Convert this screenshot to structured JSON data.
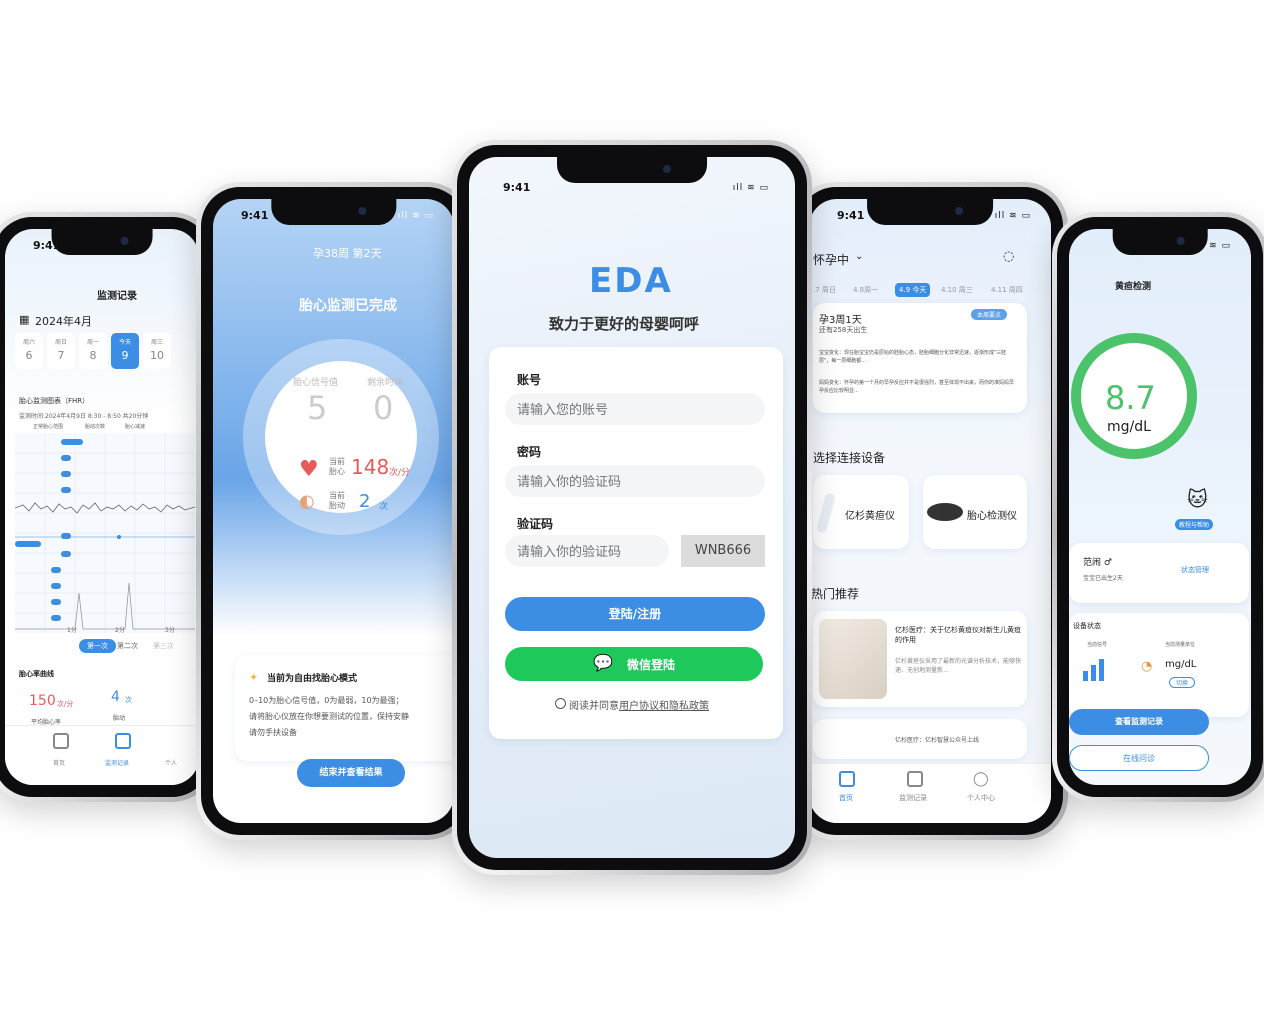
{
  "status": {
    "time": "9:41",
    "icons": "ıll ≋ ▭"
  },
  "p1": {
    "title": "监测记录",
    "month": "2024年4月",
    "days": [
      {
        "w": "周六",
        "d": "6"
      },
      {
        "w": "周日",
        "d": "7"
      },
      {
        "w": "周一",
        "d": "8"
      },
      {
        "w": "今天",
        "d": "9"
      },
      {
        "w": "周三",
        "d": "10"
      }
    ],
    "chart_title": "胎心监测图表（FHR）",
    "chart_time": "监测时间:2024年4月9日 8:30 - 8:50  共20分钟",
    "legend": [
      "正常胎心范围",
      "胎动次数",
      "胎心减速"
    ],
    "chart_ticks": [
      "1分",
      "2分",
      "3分"
    ],
    "toggles": [
      "第一次",
      "第二次",
      "第三次"
    ],
    "section": "胎心率曲线",
    "stats": [
      {
        "value": "150",
        "unit": "次/分",
        "label": "平均胎心率"
      },
      {
        "value": "4",
        "unit": "次",
        "label": "胎动"
      }
    ],
    "tabs": [
      "首页",
      "监测记录",
      "个人"
    ]
  },
  "p2": {
    "header": "孕38周  第2天",
    "title": "胎心监测已完成",
    "col1_label": "胎心信号值",
    "col2_label": "剩余时间",
    "col1_value": "5",
    "col2_value": "0",
    "hr_label": "当前\n胎心",
    "hr_value": "148",
    "hr_unit": "次/分",
    "mv_label": "当前\n胎动",
    "mv_value": "2",
    "mv_unit": "次",
    "mode_title": "当前为自由找胎心模式",
    "mode_text1": "0–10为胎心信号值，0为最弱，10为最强；",
    "mode_text2": "请将胎心仪放在你想要测试的位置，保持安静",
    "mode_text3": "请勿手扶设备",
    "button": "结束并查看结果"
  },
  "p3": {
    "logo": "EDA",
    "slogan": "致力于更好的母婴呵呼",
    "account_label": "账号",
    "account_placeholder": "请输入您的账号",
    "password_label": "密码",
    "password_placeholder": "请输入你的验证码",
    "code_label": "验证码",
    "code_placeholder": "请输入你的验证码",
    "captcha": "WNB666",
    "login_button": "登陆/注册",
    "wechat_button": "微信登陆",
    "agreement_prefix": "阅读并同意",
    "agreement_link": "用户协议和隐私政策"
  },
  "p4": {
    "status": "怀孕中",
    "dates": [
      ".7 周日",
      "4.8周一",
      "4.9 今天",
      "4.10 周三",
      "4.11 周四"
    ],
    "week_title": "孕3周1天",
    "week_sub": "还有258天出生",
    "badge": "本周要点",
    "baby_text": "宝宝变化：现在胎宝宝仍是原始的胚胎心态，胚胎细胞分化非常迅速，逐渐形成\"三胚层\"，每一层细胞都...",
    "mom_text": "妈妈变化：怀孕的第一个月的早孕反应并不是很强烈，甚至体现不出来，而你的准妈妈早孕反应比较明显...",
    "device_section": "选择连接设备",
    "devices": [
      "亿杉黄疸仪",
      "胎心检测仪"
    ],
    "hot_section": "热门推荐",
    "article_title": "亿杉医疗：关于亿杉黄疸仪对新生儿黄疸的作用",
    "article_text": "亿杉黄疸仪采用了最新的光谱分析技术，能够快速、无创地测量新...",
    "article2_title": "亿杉医疗：亿杉智慧公众号上线",
    "tabs": [
      "首页",
      "监测记录",
      "个人中心"
    ]
  },
  "p5": {
    "title": "黄疸检测",
    "value": "8.7",
    "unit": "mg/dL",
    "help": "教程与帮助",
    "baby_name": "范闹 ♂",
    "baby_sub": "宝宝已出生2天",
    "status_link": "状态管理",
    "device_state": "设备状态",
    "signal_label": "当前信号",
    "unit_label": "当前测量单位",
    "unit_value": "mg/dL",
    "switch": "切换",
    "btn_records": "查看监测记录",
    "btn_consult": "在线问诊"
  },
  "colors": {
    "accent": "#3b8ee3",
    "green": "#1ec85a",
    "red": "#e85a5a",
    "gauge": "#4cc26a"
  }
}
